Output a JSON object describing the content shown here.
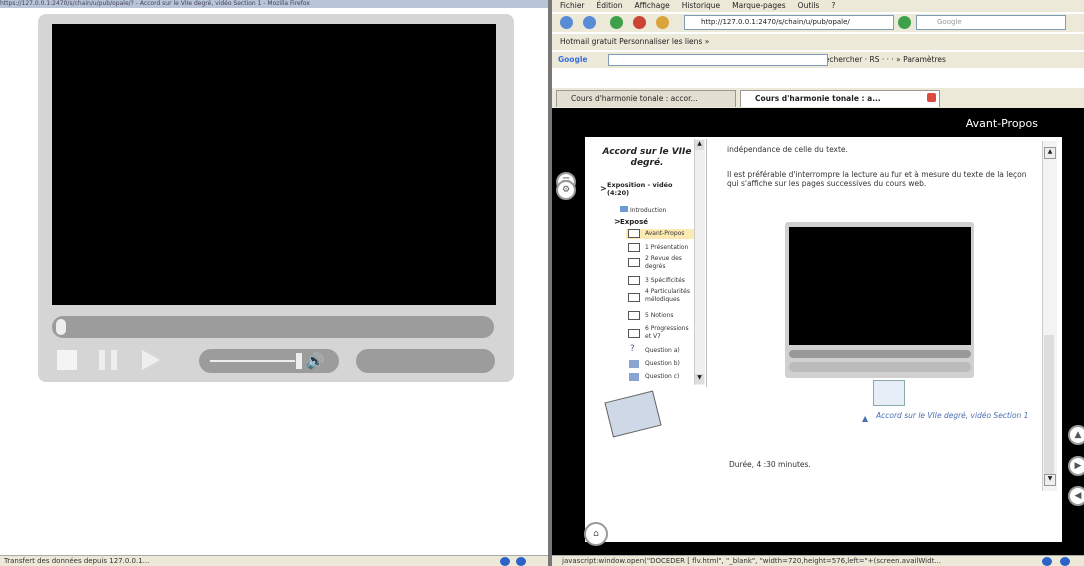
{
  "left_window": {
    "title_strip": "https://127.0.0.1:2470/s/chain/u/pub/opale/? - Accord sur le VIIe degré, vidéo Section 1 - Mozilla Firefox",
    "status_text": "Transfert des données depuis 127.0.0.1..."
  },
  "right_window": {
    "menu": [
      "Fichier",
      "Édition",
      "Affichage",
      "Historique",
      "Marque-pages",
      "Outils",
      "?"
    ],
    "url": "http://127.0.0.1:2470/s/chain/u/pub/opale/",
    "search_placeholder": "Google",
    "bookmarks": "Hotmail gratuit   Personnaliser les liens   »",
    "google_bar": "Google",
    "google_bar_items": "Rechercher  ·  RS ·  ·  ·  »   Paramètres",
    "tabs": [
      "Cours d'harmonie tonale : accor...",
      "Cours d'harmonie tonale : a..."
    ],
    "page_heading": "Avant-Propos",
    "toc": {
      "title": "Accord sur le VIIe degré.",
      "section": "Exposition - vidéo (4:20)",
      "introduction": "Introduction",
      "expose": "Exposé",
      "items": [
        "Avant-Propos",
        "1 Présentation",
        "2 Revue des degrés",
        "3 Spécificités",
        "4 Particularités mélodiques",
        "5 Notions",
        "6 Progressions et V7",
        "Question a)",
        "Question b)",
        "Question c)"
      ]
    },
    "content": {
      "text_top": "indépendance de celle du texte.",
      "text_main": "Il est préférable d'interrompre la lecture au fur et à mesure du texte de la leçon qui s'affiche sur les pages successives du cours web.",
      "video_link": "Accord sur le VIIe degré, vidéo Section 1",
      "duration": "Durée, 4 :30 minutes."
    },
    "status_text": "javascript:window.open(\"DOCEDER [ flv.html\", \"_blank\", \"width=720,height=576,left=\"+(screen.availWidt..."
  }
}
